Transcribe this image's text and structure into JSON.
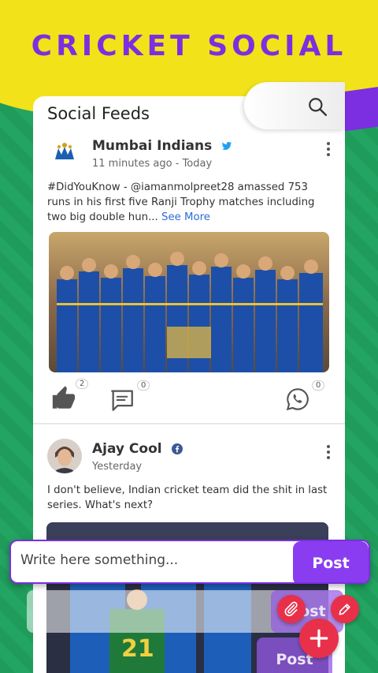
{
  "app": {
    "title": "CRICKET SOCIAL"
  },
  "feed": {
    "title": "Social Feeds",
    "search_icon": "search-icon"
  },
  "posts": [
    {
      "author": "Mumbai Indians",
      "verified": "twitter",
      "time": "11 minutes ago",
      "time_suffix": "- Today",
      "text": "#DidYouKnow - @iamanmolpreet28 amassed 753 runs in his first five Ranji Trophy matches including two big double hun...",
      "see_more": "See More",
      "likes": "2",
      "comments": "0",
      "shares": "0"
    },
    {
      "author": "Ajay Cool",
      "verified": "facebook",
      "time": "Yesterday",
      "text": "I don't believe, Indian cricket team did the shit in last series. What's next?"
    }
  ],
  "composer": {
    "placeholder": "Write here something...",
    "post_label": "Post",
    "ghost_post_1": "Post",
    "ghost_post_2": "Post"
  },
  "colors": {
    "brand_purple": "#7b2fe0",
    "accent_red": "#e8304a",
    "yellow": "#f2e21a",
    "green": "#1f9b5a"
  }
}
